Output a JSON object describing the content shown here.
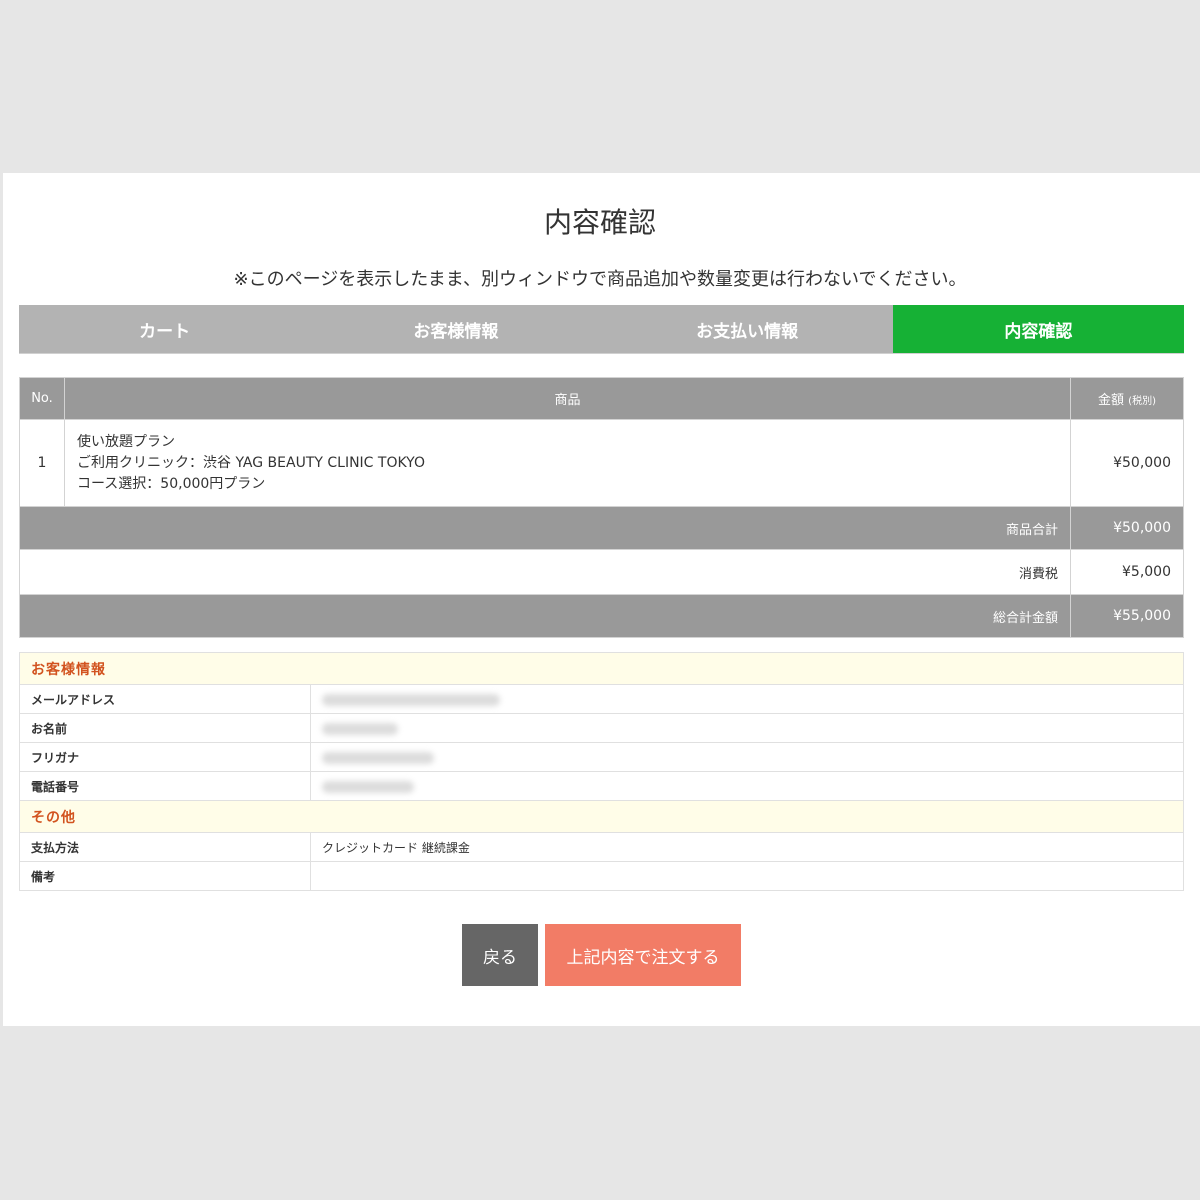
{
  "page": {
    "title": "内容確認",
    "notice": "※このページを表示したまま、別ウィンドウで商品追加や数量変更は行わないでください。"
  },
  "steps": [
    {
      "label": "カート",
      "active": false
    },
    {
      "label": "お客様情報",
      "active": false
    },
    {
      "label": "お支払い情報",
      "active": false
    },
    {
      "label": "内容確認",
      "active": true
    }
  ],
  "order": {
    "headers": {
      "no": "No.",
      "item": "商品",
      "amount": "金額",
      "amount_note": "(税別)"
    },
    "items": [
      {
        "no": "1",
        "name": "使い放題プラン",
        "clinic": "ご利用クリニック：渋谷 YAG BEAUTY CLINIC TOKYO",
        "course": "コース選択：50,000円プラン",
        "amount": "¥50,000"
      }
    ],
    "subtotal_label": "商品合計",
    "subtotal": "¥50,000",
    "tax_label": "消費税",
    "tax": "¥5,000",
    "total_label": "総合計金額",
    "total": "¥55,000"
  },
  "customer": {
    "section_title": "お客様情報",
    "email_label": "メールアドレス",
    "name_label": "お名前",
    "kana_label": "フリガナ",
    "phone_label": "電話番号"
  },
  "other": {
    "section_title": "その他",
    "payment_label": "支払方法",
    "payment_value": "クレジットカード 継続課金",
    "notes_label": "備考",
    "notes_value": ""
  },
  "buttons": {
    "back": "戻る",
    "submit": "上記内容で注文する"
  },
  "colors": {
    "active_step": "#16b135",
    "submit_button": "#f27c66",
    "section_heading": "#d2531f"
  }
}
